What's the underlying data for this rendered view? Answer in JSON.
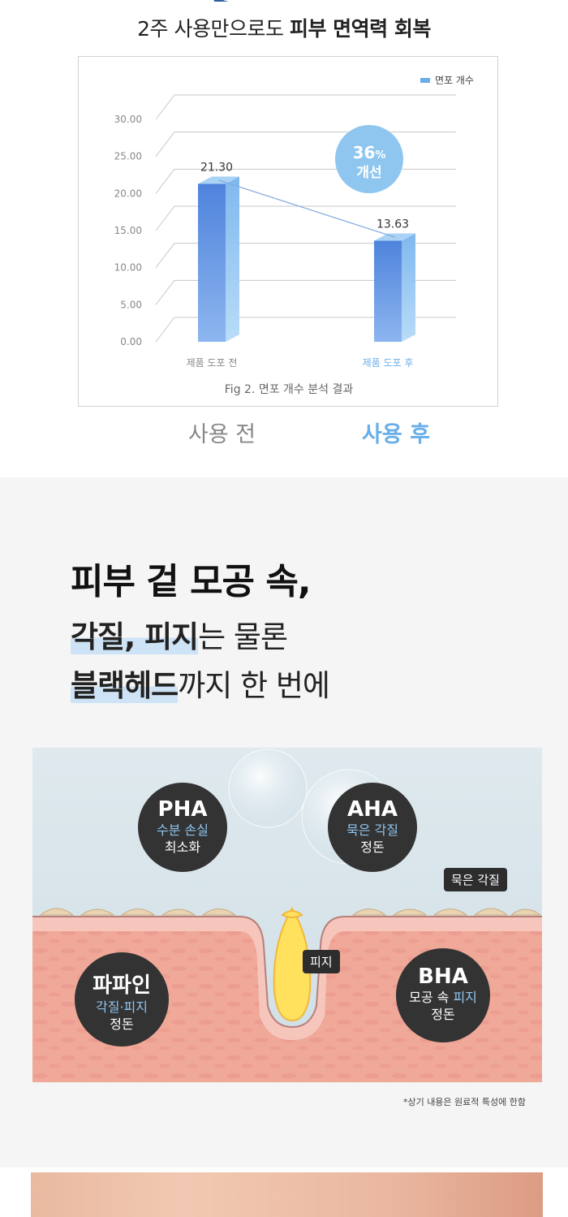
{
  "headline": {
    "pre": "2주 사용만으로도 ",
    "bold": "피부 면역력 회복"
  },
  "chart_data": {
    "type": "bar",
    "categories": [
      "제품 도포 전",
      "제품 도포 후"
    ],
    "series": [
      {
        "name": "면포 개수",
        "values": [
          21.3,
          13.63
        ]
      }
    ],
    "value_labels": [
      "21.30",
      "13.63"
    ],
    "ylim": [
      0,
      30
    ],
    "yticks": [
      "0.00",
      "5.00",
      "10.00",
      "15.00",
      "20.00",
      "25.00",
      "30.00"
    ],
    "caption": "Fig 2. 면포 개수 분석 결과",
    "badge": {
      "pct": "36",
      "unit": "%",
      "text": "개선"
    },
    "grid": true,
    "legend": "top-right",
    "colors": {
      "bar_front": "#5b8ee0",
      "bar_side": "#8cc0ee",
      "badge": "#8ec6f0"
    }
  },
  "labels": {
    "before": "사용 전",
    "after": "사용 후"
  },
  "section2": {
    "line1": "피부 겉 모공 속,",
    "line2_hl": "각질, 피지",
    "line2_rest": "는 물론",
    "line3_hl": "블랙헤드",
    "line3_rest": "까지 한 번에"
  },
  "illus": {
    "pha": {
      "title": "PHA",
      "l1": "수분 손실",
      "l2": "최소화"
    },
    "aha": {
      "title": "AHA",
      "l1": "묵은 각질",
      "l2": "정돈"
    },
    "papain": {
      "title": "파파인",
      "l1": "각질·피지",
      "l2": "정돈"
    },
    "bha": {
      "title": "BHA",
      "l1a": "모공 속 ",
      "l1b": "피지",
      "l2": "정돈"
    },
    "tag_keratin": "묵은 각질",
    "tag_sebum": "피지"
  },
  "note": "*상기 내용은 원료적 특성에 한함"
}
